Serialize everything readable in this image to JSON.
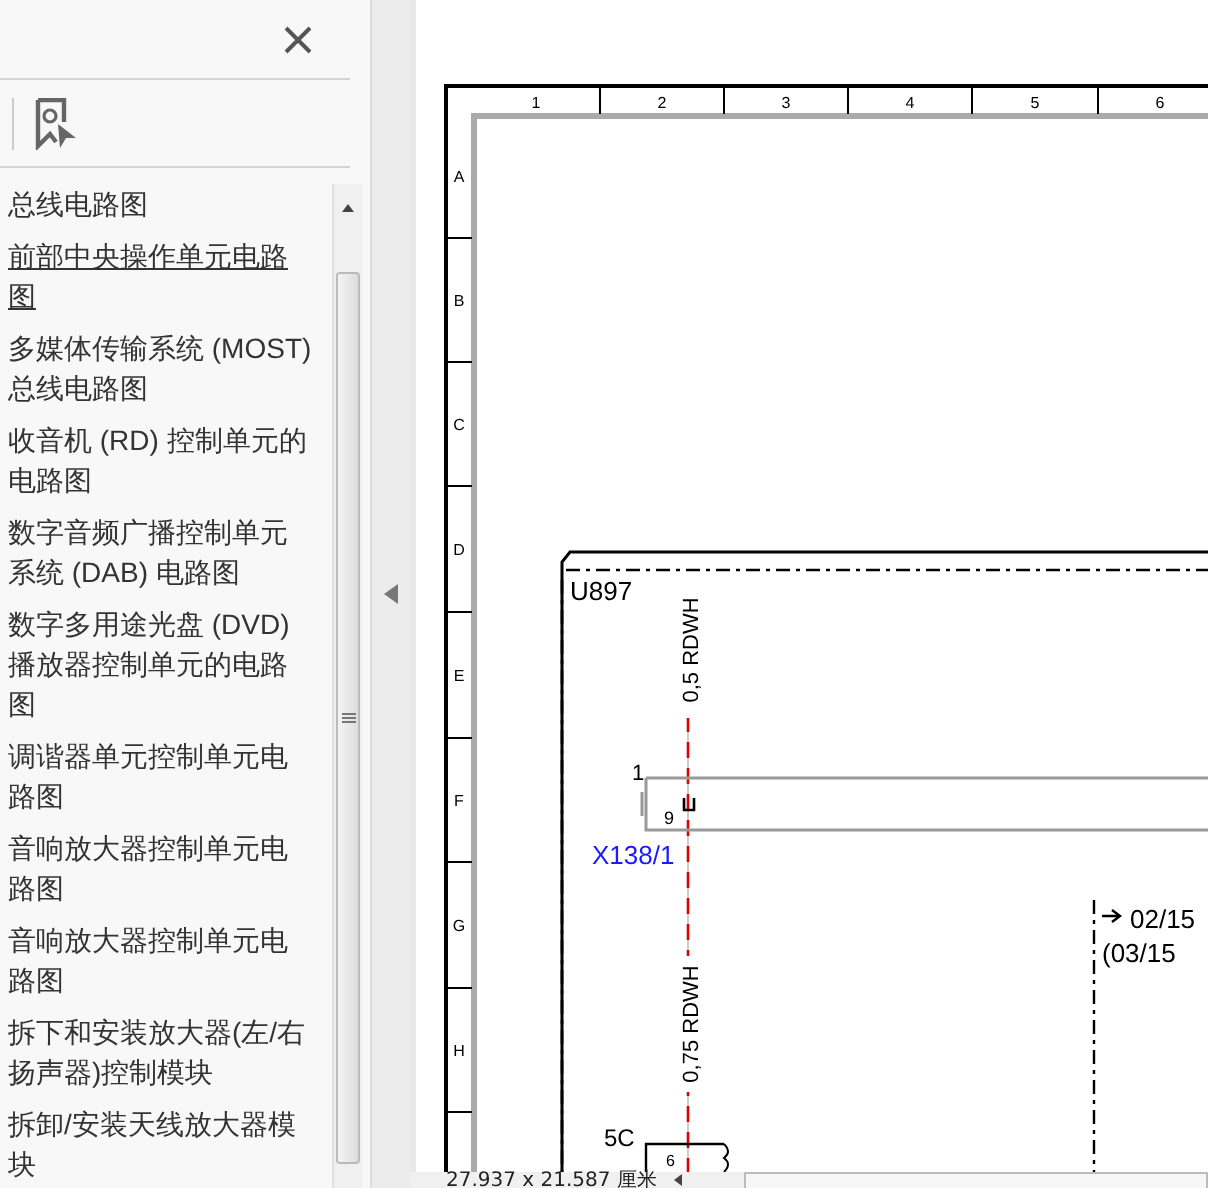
{
  "bookmarks": [
    {
      "label": "总线电路图",
      "selected": false
    },
    {
      "label": "前部中央操作单元电路图",
      "selected": true
    },
    {
      "label": "多媒体传输系统 (MOST) 总线电路图",
      "selected": false
    },
    {
      "label": "收音机 (RD) 控制单元的电路图",
      "selected": false
    },
    {
      "label": "数字音频广播控制单元系统 (DAB) 电路图",
      "selected": false
    },
    {
      "label": "数字多用途光盘 (DVD) 播放器控制单元的电路图",
      "selected": false
    },
    {
      "label": "调谐器单元控制单元电路图",
      "selected": false
    },
    {
      "label": "音响放大器控制单元电路图",
      "selected": false
    },
    {
      "label": "音响放大器控制单元电路图",
      "selected": false
    },
    {
      "label": "拆下和安装放大器(左/右扬声器)控制模块",
      "selected": false
    },
    {
      "label": "拆卸/安装天线放大器模块",
      "selected": false
    }
  ],
  "drawing": {
    "columns": [
      "1",
      "2",
      "3",
      "4",
      "5",
      "6"
    ],
    "rows": [
      "A",
      "B",
      "C",
      "D",
      "E",
      "F",
      "G",
      "H"
    ],
    "module": "U897",
    "wire_upper": "0,5 RDWH",
    "wire_lower": "0,75 RDWH",
    "connector_num": "1",
    "pin": "9",
    "connector": "X138/1",
    "connector_lower": "5C",
    "pin_lower": "6",
    "ref_1": "02/15",
    "ref_2": "(03/15"
  },
  "status_bar": {
    "size": "27.937 x 21.587 厘米"
  }
}
